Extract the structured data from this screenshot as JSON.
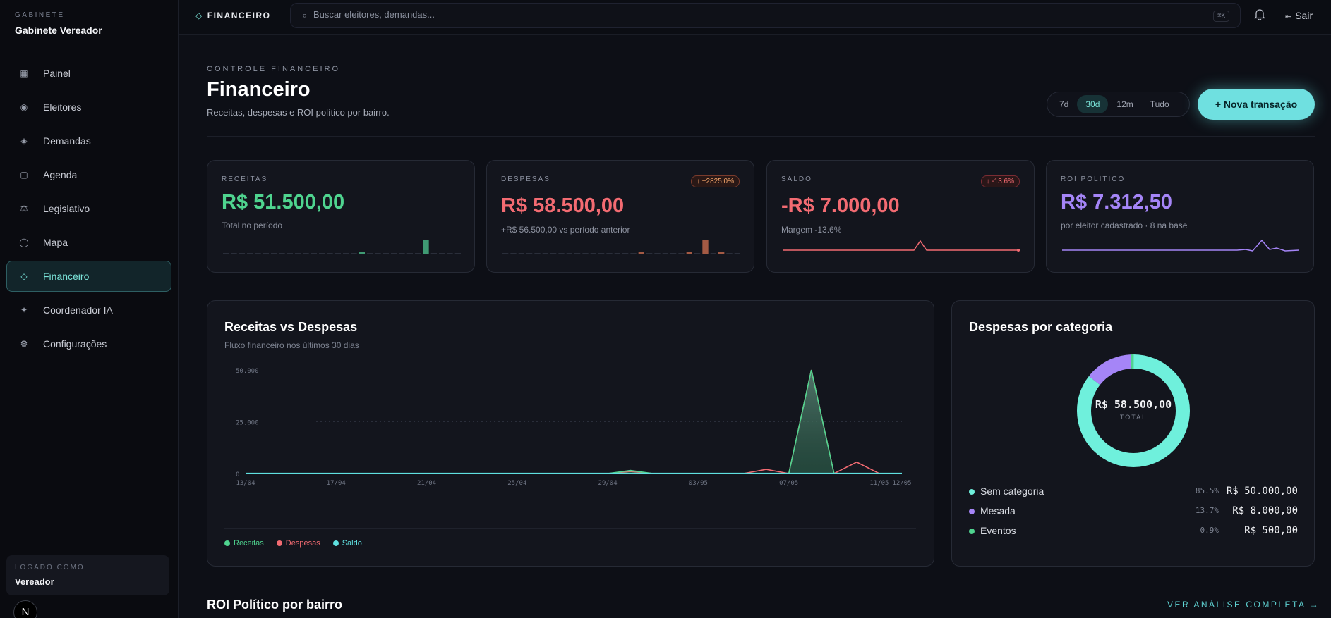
{
  "sidebar": {
    "kicker": "GABINETE",
    "name": "Gabinete Vereador",
    "items": [
      {
        "label": "Painel",
        "icon": "▦"
      },
      {
        "label": "Eleitores",
        "icon": "◉"
      },
      {
        "label": "Demandas",
        "icon": "◈"
      },
      {
        "label": "Agenda",
        "icon": "▢"
      },
      {
        "label": "Legislativo",
        "icon": "⚖"
      },
      {
        "label": "Mapa",
        "icon": "◯"
      },
      {
        "label": "Financeiro",
        "icon": "◇"
      },
      {
        "label": "Coordenador IA",
        "icon": "✦"
      },
      {
        "label": "Configurações",
        "icon": "⚙"
      }
    ],
    "active_index": 6,
    "logged_kicker": "LOGADO COMO",
    "logged_name": "Vereador",
    "badge": "N"
  },
  "topbar": {
    "crumb": "FINANCEIRO",
    "search_placeholder": "Buscar eleitores, demandas...",
    "shortcut": "⌘K",
    "logout": "Sair"
  },
  "header": {
    "kicker": "CONTROLE FINANCEIRO",
    "title": "Financeiro",
    "subtitle": "Receitas, despesas e ROI político por bairro.",
    "ranges": [
      "7d",
      "30d",
      "12m",
      "Tudo"
    ],
    "range_selected": "30d",
    "new_button": "+ Nova transação"
  },
  "kpis": {
    "receitas": {
      "label": "RECEITAS",
      "value": "R$ 51.500,00",
      "sub": "Total no período",
      "color": "#4fd48f"
    },
    "despesas": {
      "label": "DESPESAS",
      "value": "R$ 58.500,00",
      "sub": "+R$ 56.500,00 vs período anterior",
      "badge": "↑ +2825.0%",
      "color": "#f36b72"
    },
    "saldo": {
      "label": "SALDO",
      "value": "-R$ 7.000,00",
      "sub": "Margem -13.6%",
      "badge": "↓ -13.6%",
      "color": "#f36b72"
    },
    "roi": {
      "label": "ROI POLÍTICO",
      "value": "R$ 7.312,50",
      "sub": "por eleitor cadastrado · 8 na base",
      "color": "#a585f7"
    }
  },
  "flow_chart": {
    "title": "Receitas vs Despesas",
    "subtitle": "Fluxo financeiro nos últimos 30 dias",
    "legend": [
      {
        "name": "Receitas",
        "color": "#4fd48f"
      },
      {
        "name": "Despesas",
        "color": "#f36b72"
      },
      {
        "name": "Saldo",
        "color": "#5fe0e0"
      }
    ]
  },
  "chart_data": {
    "type": "area",
    "title": "Receitas vs Despesas",
    "subtitle": "Fluxo financeiro nos últimos 30 dias",
    "xlabel": "",
    "ylabel": "",
    "ylim": [
      0,
      50000
    ],
    "yticks": [
      "50.000",
      "25.000",
      "0"
    ],
    "xticks": [
      "13/04",
      "17/04",
      "21/04",
      "25/04",
      "29/04",
      "03/05",
      "07/05",
      "11/05",
      "12/05"
    ],
    "x": [
      "13/04",
      "14/04",
      "15/04",
      "16/04",
      "17/04",
      "18/04",
      "19/04",
      "20/04",
      "21/04",
      "22/04",
      "23/04",
      "24/04",
      "25/04",
      "26/04",
      "27/04",
      "28/04",
      "29/04",
      "30/04",
      "01/05",
      "02/05",
      "03/05",
      "04/05",
      "05/05",
      "06/05",
      "07/05",
      "08/05",
      "09/05",
      "10/05",
      "11/05",
      "12/05"
    ],
    "series": [
      {
        "name": "Receitas",
        "color": "#4fd48f",
        "values": [
          0,
          0,
          0,
          0,
          0,
          0,
          0,
          0,
          0,
          0,
          0,
          0,
          0,
          0,
          0,
          0,
          0,
          1500,
          0,
          0,
          0,
          0,
          0,
          0,
          0,
          50000,
          0,
          0,
          0,
          0
        ]
      },
      {
        "name": "Despesas",
        "color": "#f36b72",
        "values": [
          0,
          0,
          0,
          0,
          0,
          0,
          0,
          0,
          0,
          0,
          0,
          0,
          0,
          0,
          0,
          0,
          0,
          1000,
          0,
          0,
          0,
          0,
          0,
          2000,
          0,
          50000,
          0,
          5500,
          0,
          0
        ]
      }
    ],
    "legend_position": "bottom-left",
    "grid": true
  },
  "categories": {
    "title": "Despesas por categoria",
    "total_value": "R$ 58.500,00",
    "total_label": "TOTAL",
    "rows": [
      {
        "name": "Sem categoria",
        "pct": "85.5%",
        "value": "R$ 50.000,00",
        "share": 0.855,
        "color": "#6ff0dc"
      },
      {
        "name": "Mesada",
        "pct": "13.7%",
        "value": "R$ 8.000,00",
        "share": 0.137,
        "color": "#a585f7"
      },
      {
        "name": "Eventos",
        "pct": "0.9%",
        "value": "R$ 500,00",
        "share": 0.009,
        "color": "#4fd48f"
      }
    ]
  },
  "roi_section": {
    "title": "ROI Político por bairro",
    "link": "VER ANÁLISE COMPLETA →"
  }
}
